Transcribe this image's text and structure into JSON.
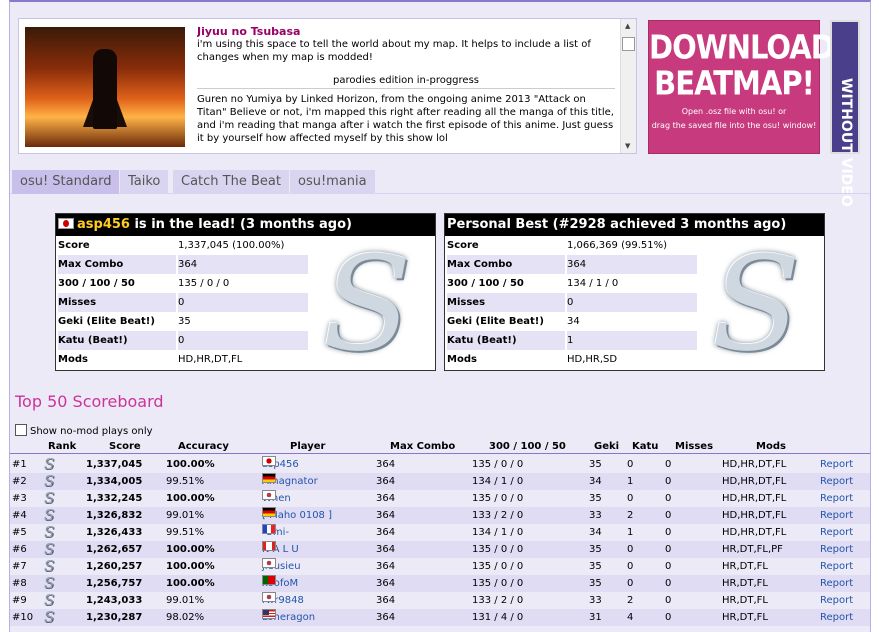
{
  "map": {
    "title": "Jiyuu no Tsubasa",
    "intro": "i'm using this space to tell the world about my map. It helps to include a list of changes when my map is modded!",
    "edition": "parodies edition in-proggress",
    "description": "Guren no Yumiya by Linked Horizon, from the ongoing anime 2013 \"Attack on Titan\" Believe or not, i'm mapped this right after reading all the manga of this title, and i'm reading that manga after i watch the first episode of this anime. Just guess it by yourself how affected myself by this show lol"
  },
  "download": {
    "line1": "DOWNLOAD",
    "line2": "BEATMAP!",
    "hint1": "Open .osz file with osu! or",
    "hint2": "drag the saved file into the osu! window!",
    "no_video": "WITHOUT VIDEO"
  },
  "tabs": [
    {
      "label": "osu! Standard"
    },
    {
      "label": "Taiko"
    },
    {
      "label": "Catch The Beat"
    },
    {
      "label": "osu!mania"
    }
  ],
  "leader": {
    "name": "asp456",
    "header_rest": " is in the lead! (3 months ago)",
    "rows": [
      {
        "k": "Score",
        "v": "1,337,045 (100.00%)"
      },
      {
        "k": "Max Combo",
        "v": "364"
      },
      {
        "k": "300 / 100 / 50",
        "v": "135 / 0 / 0"
      },
      {
        "k": "Misses",
        "v": "0"
      },
      {
        "k": "Geki (Elite Beat!)",
        "v": "35"
      },
      {
        "k": "Katu (Beat!)",
        "v": "0"
      },
      {
        "k": "Mods",
        "v": "HD,HR,DT,FL"
      }
    ],
    "grade": "S"
  },
  "personal": {
    "header": "Personal Best (#2928 achieved 3 months ago)",
    "rows": [
      {
        "k": "Score",
        "v": "1,066,369 (99.51%)"
      },
      {
        "k": "Max Combo",
        "v": "364"
      },
      {
        "k": "300 / 100 / 50",
        "v": "134 / 1 / 0"
      },
      {
        "k": "Misses",
        "v": "0"
      },
      {
        "k": "Geki (Elite Beat!)",
        "v": "34"
      },
      {
        "k": "Katu (Beat!)",
        "v": "1"
      },
      {
        "k": "Mods",
        "v": "HD,HR,SD"
      }
    ],
    "grade": "S"
  },
  "scoreboard": {
    "title": "Top 50 Scoreboard",
    "nomod_label": "Show no-mod plays only",
    "columns": [
      "Rank",
      "Score",
      "Accuracy",
      "Player",
      "Max Combo",
      "300 / 100 / 50",
      "Geki",
      "Katu",
      "Misses",
      "Mods"
    ],
    "report_label": "Report",
    "rows": [
      {
        "pos": "#1",
        "grade": "S",
        "score": "1,337,045",
        "acc": "100.00%",
        "acc_bold": true,
        "flag": "jp",
        "player": "asp456",
        "combo": "364",
        "hits": "135  /  0  /  0",
        "geki": "35",
        "katu": "0",
        "miss": "0",
        "mods": "HD,HR,DT,FL"
      },
      {
        "pos": "#2",
        "grade": "S",
        "score": "1,334,005",
        "acc": "99.51%",
        "acc_bold": false,
        "flag": "de",
        "player": "Amagnator",
        "combo": "364",
        "hits": "134  /  1  /  0",
        "geki": "34",
        "katu": "1",
        "miss": "0",
        "mods": "HD,HR,DT,FL"
      },
      {
        "pos": "#3",
        "grade": "S",
        "score": "1,332,245",
        "acc": "100.00%",
        "acc_bold": true,
        "flag": "kr",
        "player": "When",
        "combo": "364",
        "hits": "135  /  0  /  0",
        "geki": "35",
        "katu": "0",
        "miss": "0",
        "mods": "HD,HR,DT,FL"
      },
      {
        "pos": "#4",
        "grade": "S",
        "score": "1,326,832",
        "acc": "99.01%",
        "acc_bold": false,
        "flag": "de",
        "player": "[ Maho 0108 ]",
        "combo": "364",
        "hits": "133  /  2  /  0",
        "geki": "33",
        "katu": "2",
        "miss": "0",
        "mods": "HD,HR,DT,FL"
      },
      {
        "pos": "#5",
        "grade": "S",
        "score": "1,326,433",
        "acc": "99.51%",
        "acc_bold": false,
        "flag": "fr",
        "player": "-Umi-",
        "combo": "364",
        "hits": "134  /  1  /  0",
        "geki": "34",
        "katu": "1",
        "miss": "0",
        "mods": "HD,HR,DT,FL"
      },
      {
        "pos": "#6",
        "grade": "S",
        "score": "1,262,657",
        "acc": "100.00%",
        "acc_bold": true,
        "flag": "ca",
        "player": "N A L U",
        "combo": "364",
        "hits": "135  /  0  /  0",
        "geki": "35",
        "katu": "0",
        "miss": "0",
        "mods": "HR,DT,FL,PF"
      },
      {
        "pos": "#7",
        "grade": "S",
        "score": "1,260,257",
        "acc": "100.00%",
        "acc_bold": true,
        "flag": "kr",
        "player": "jieusieu",
        "combo": "364",
        "hits": "135  /  0  /  0",
        "geki": "35",
        "katu": "0",
        "miss": "0",
        "mods": "HR,DT,FL"
      },
      {
        "pos": "#8",
        "grade": "S",
        "score": "1,256,757",
        "acc": "100.00%",
        "acc_bold": true,
        "flag": "pt",
        "player": "xoofoM",
        "combo": "364",
        "hits": "135  /  0  /  0",
        "geki": "35",
        "katu": "0",
        "miss": "0",
        "mods": "HR,DT,FL"
      },
      {
        "pos": "#9",
        "grade": "S",
        "score": "1,243,033",
        "acc": "99.01%",
        "acc_bold": false,
        "flag": "kr",
        "player": "rwr9848",
        "combo": "364",
        "hits": "133  /  2  /  0",
        "geki": "33",
        "katu": "2",
        "miss": "0",
        "mods": "HR,DT,FL"
      },
      {
        "pos": "#10",
        "grade": "S",
        "score": "1,230,287",
        "acc": "98.02%",
        "acc_bold": false,
        "flag": "us",
        "player": "Loneragon",
        "combo": "364",
        "hits": "131  /  4  /  0",
        "geki": "31",
        "katu": "4",
        "miss": "0",
        "mods": "HR,DT,FL"
      }
    ]
  }
}
